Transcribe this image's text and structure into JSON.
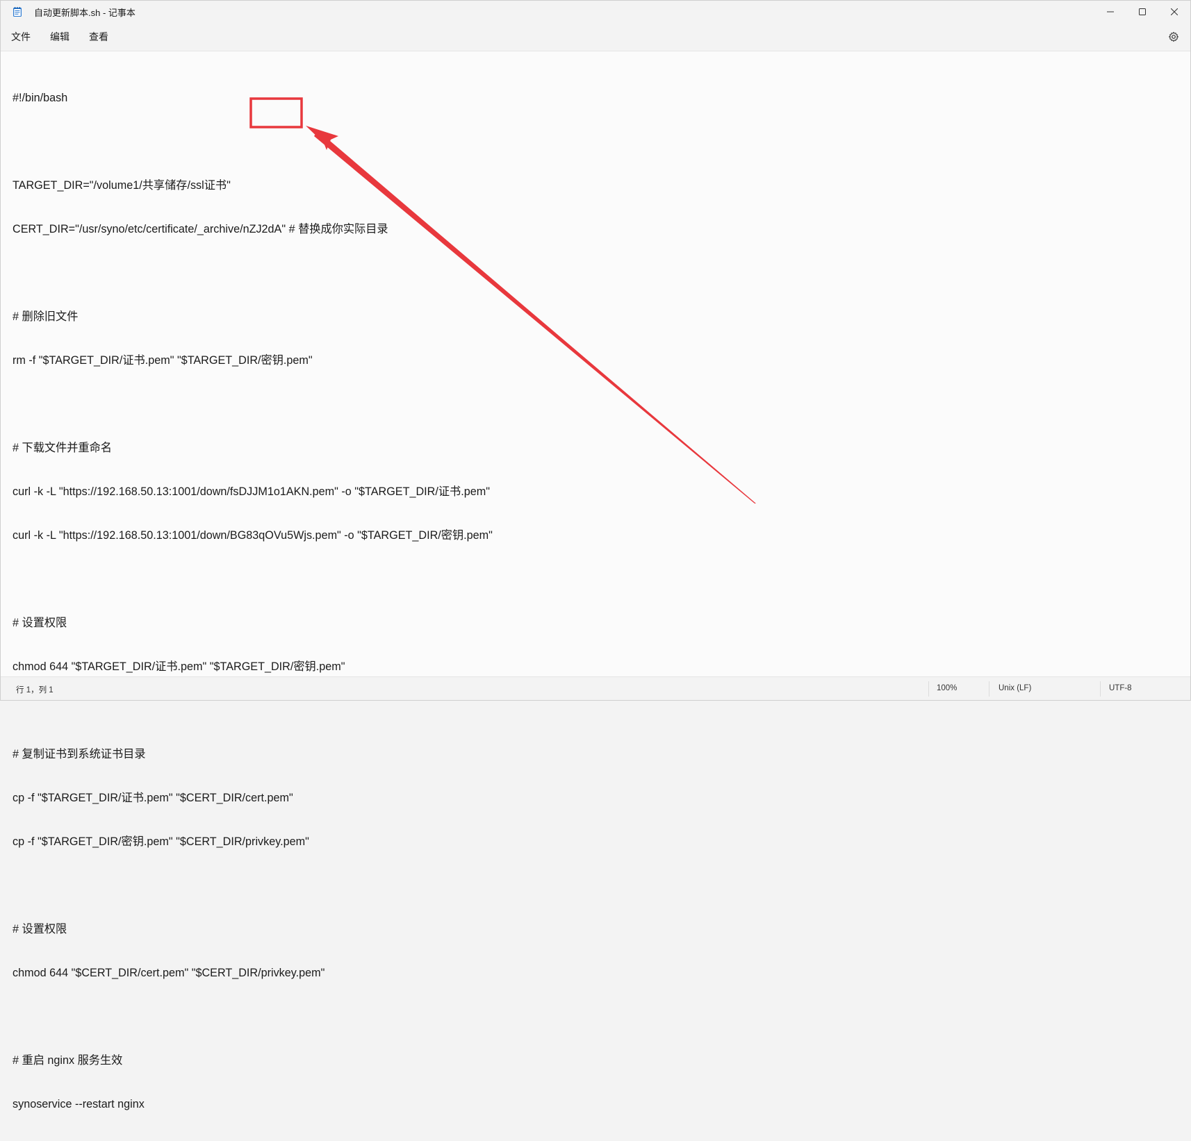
{
  "window": {
    "title": "自动更新脚本.sh - 记事本"
  },
  "menu": {
    "file": "文件",
    "edit": "编辑",
    "view": "查看"
  },
  "editor": {
    "lines": [
      "#!/bin/bash",
      "",
      "TARGET_DIR=\"/volume1/共享储存/ssl证书\"",
      "CERT_DIR=\"/usr/syno/etc/certificate/_archive/nZJ2dA\" # 替换成你实际目录",
      "",
      "# 删除旧文件",
      "rm -f \"$TARGET_DIR/证书.pem\" \"$TARGET_DIR/密钥.pem\"",
      "",
      "# 下载文件并重命名",
      "curl -k -L \"https://192.168.50.13:1001/down/fsDJJM1o1AKN.pem\" -o \"$TARGET_DIR/证书.pem\"",
      "curl -k -L \"https://192.168.50.13:1001/down/BG83qOVu5Wjs.pem\" -o \"$TARGET_DIR/密钥.pem\"",
      "",
      "# 设置权限",
      "chmod 644 \"$TARGET_DIR/证书.pem\" \"$TARGET_DIR/密钥.pem\"",
      "",
      "# 复制证书到系统证书目录",
      "cp -f \"$TARGET_DIR/证书.pem\" \"$CERT_DIR/cert.pem\"",
      "cp -f \"$TARGET_DIR/密钥.pem\" \"$CERT_DIR/privkey.pem\"",
      "",
      "# 设置权限",
      "chmod 644 \"$CERT_DIR/cert.pem\" \"$CERT_DIR/privkey.pem\"",
      "",
      "# 重启 nginx 服务生效",
      "synoservice --restart nginx"
    ]
  },
  "status": {
    "position": "行 1，列 1",
    "zoom": "100%",
    "line_ending": "Unix (LF)",
    "encoding": "UTF-8"
  },
  "colors": {
    "annotation": "#e8383d"
  },
  "icons": {
    "app": "notepad-icon",
    "minimize": "minimize-icon",
    "maximize": "maximize-icon",
    "close": "close-icon",
    "settings": "gear-icon"
  }
}
